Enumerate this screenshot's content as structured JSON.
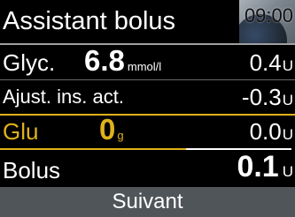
{
  "header": {
    "title": "Assistant bolus",
    "time": "09:00"
  },
  "glyc": {
    "label": "Glyc.",
    "value": "6.8",
    "value_unit": "mmol/l",
    "insulin": "0.4",
    "insulin_unit": "U"
  },
  "active_insulin": {
    "label": "Ajust. ins. act.",
    "insulin": "-0.3",
    "insulin_unit": "U"
  },
  "carbs": {
    "label": "Glu",
    "value": "0",
    "value_unit": "g",
    "insulin": "0.0",
    "insulin_unit": "U"
  },
  "bolus": {
    "label": "Bolus",
    "total": "0.1",
    "total_unit": "U"
  },
  "footer": {
    "next_label": "Suivant"
  },
  "colors": {
    "accent": "#e0b21c",
    "background": "#000000",
    "button": "#505559"
  }
}
